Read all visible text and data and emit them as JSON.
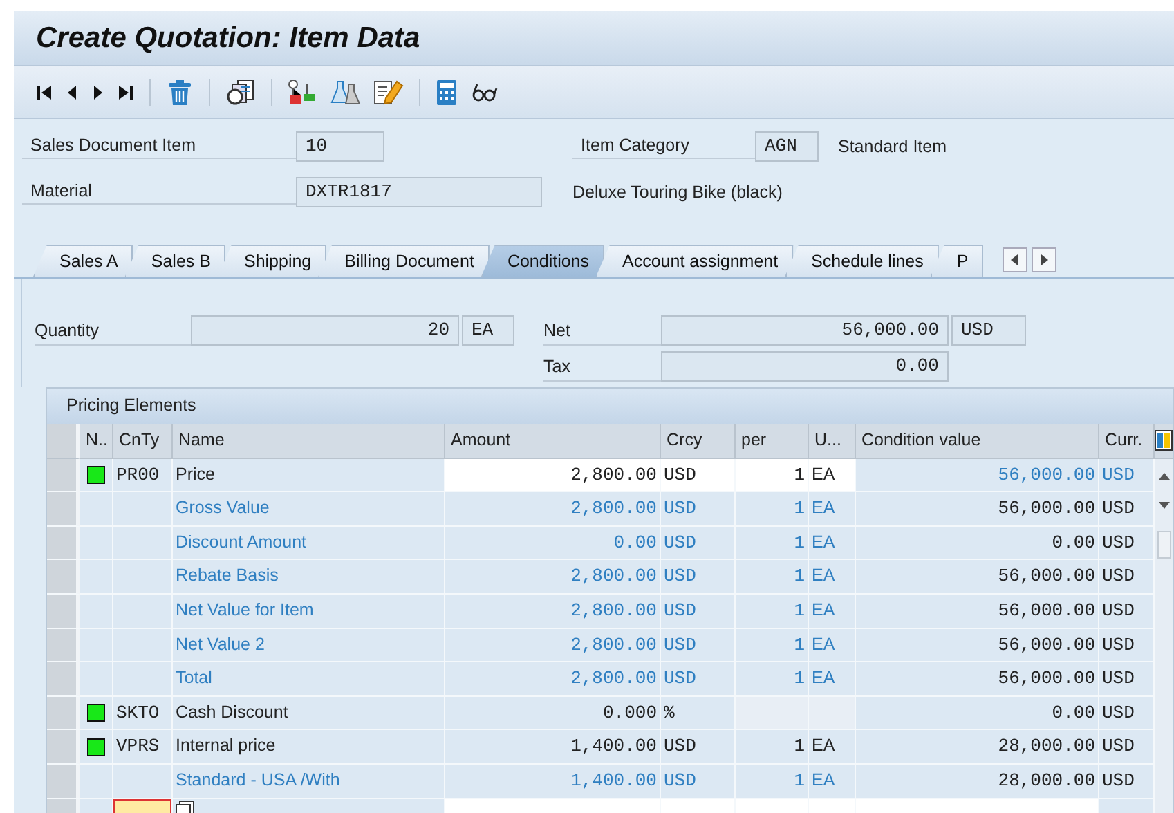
{
  "window": {
    "title": "Create Quotation: Item Data"
  },
  "header": {
    "item_label": "Sales Document Item",
    "item": "10",
    "category_label": "Item Category",
    "category": "AGN",
    "category_text": "Standard Item",
    "material_label": "Material",
    "material": "DXTR1817",
    "material_text": "Deluxe Touring Bike (black)"
  },
  "tabs": [
    {
      "label": "Sales A",
      "selected": false
    },
    {
      "label": "Sales B",
      "selected": false
    },
    {
      "label": "Shipping",
      "selected": false
    },
    {
      "label": "Billing Document",
      "selected": false
    },
    {
      "label": "Conditions",
      "selected": true
    },
    {
      "label": "Account assignment",
      "selected": false
    },
    {
      "label": "Schedule lines",
      "selected": false
    },
    {
      "label": "P",
      "selected": false
    }
  ],
  "totals": {
    "quantity_label": "Quantity",
    "quantity": "20",
    "quantity_unit": "EA",
    "net_label": "Net",
    "net": "56,000.00",
    "net_currency": "USD",
    "tax_label": "Tax",
    "tax": "0.00"
  },
  "pricing": {
    "title": "Pricing Elements",
    "columns": [
      "N..",
      "CnTy",
      "Name",
      "Amount",
      "Crcy",
      "per",
      "U...",
      "Condition value",
      "Curr."
    ],
    "rows": [
      {
        "kind": "condition",
        "indicator": true,
        "editable": true,
        "cnty": "PR00",
        "name": "Price",
        "amount": "2,800.00",
        "crcy": "USD",
        "per": "1",
        "unit": "EA",
        "value": "56,000.00",
        "curr": "USD"
      },
      {
        "kind": "subtotal",
        "indicator": false,
        "editable": false,
        "name": "Gross Value",
        "amount": "2,800.00",
        "crcy": "USD",
        "per": "1",
        "unit": "EA",
        "value": "56,000.00",
        "curr": "USD"
      },
      {
        "kind": "subtotal",
        "indicator": false,
        "editable": false,
        "name": "Discount Amount",
        "amount": "0.00",
        "crcy": "USD",
        "per": "1",
        "unit": "EA",
        "value": "0.00",
        "curr": "USD"
      },
      {
        "kind": "subtotal",
        "indicator": false,
        "editable": false,
        "name": "Rebate Basis",
        "amount": "2,800.00",
        "crcy": "USD",
        "per": "1",
        "unit": "EA",
        "value": "56,000.00",
        "curr": "USD"
      },
      {
        "kind": "subtotal",
        "indicator": false,
        "editable": false,
        "name": "Net Value for Item",
        "amount": "2,800.00",
        "crcy": "USD",
        "per": "1",
        "unit": "EA",
        "value": "56,000.00",
        "curr": "USD"
      },
      {
        "kind": "subtotal",
        "indicator": false,
        "editable": false,
        "name": "Net Value 2",
        "amount": "2,800.00",
        "crcy": "USD",
        "per": "1",
        "unit": "EA",
        "value": "56,000.00",
        "curr": "USD"
      },
      {
        "kind": "subtotal",
        "indicator": false,
        "editable": false,
        "name": "Total",
        "amount": "2,800.00",
        "crcy": "USD",
        "per": "1",
        "unit": "EA",
        "value": "56,000.00",
        "curr": "USD"
      },
      {
        "kind": "condition",
        "indicator": true,
        "editable": false,
        "cnty": "SKTO",
        "name": "Cash Discount",
        "amount": "0.000",
        "crcy": "%",
        "value": "0.00",
        "curr": "USD"
      },
      {
        "kind": "condition",
        "indicator": true,
        "editable": false,
        "cnty": "VPRS",
        "name": "Internal price",
        "amount": "1,400.00",
        "crcy": "USD",
        "per": "1",
        "unit": "EA",
        "value": "28,000.00",
        "curr": "USD"
      },
      {
        "kind": "subtotal",
        "indicator": false,
        "editable": false,
        "name": "Standard - USA /With",
        "amount": "1,400.00",
        "crcy": "USD",
        "per": "1",
        "unit": "EA",
        "value": "28,000.00",
        "curr": "USD"
      }
    ]
  }
}
